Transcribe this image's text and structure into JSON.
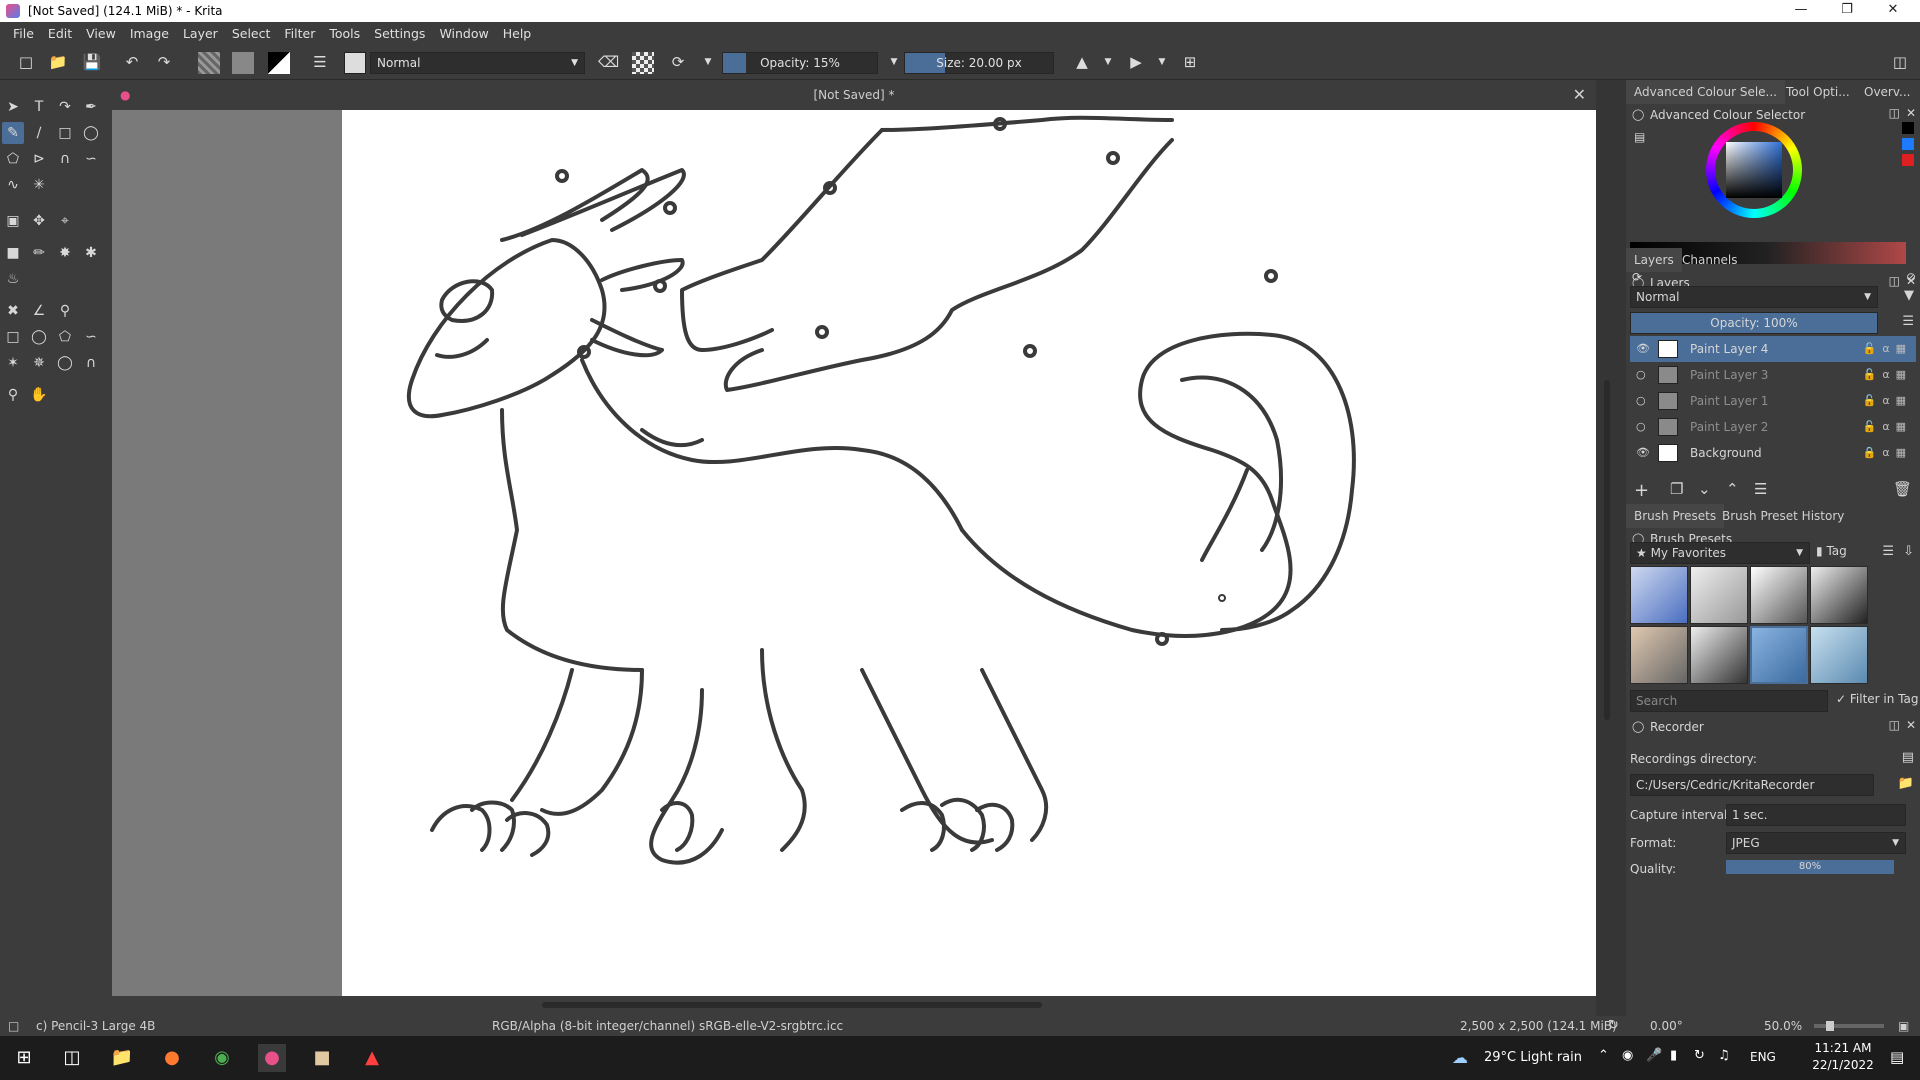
{
  "window": {
    "title": "[Not Saved]  (124.1 MiB)  * - Krita"
  },
  "menu": [
    "File",
    "Edit",
    "View",
    "Image",
    "Layer",
    "Select",
    "Filter",
    "Tools",
    "Settings",
    "Window",
    "Help"
  ],
  "toolbar": {
    "blend_mode": "Normal",
    "opacity_label": "Opacity: 15%",
    "opacity_value": 0.15,
    "size_label": "Size: 20.00 px"
  },
  "document": {
    "tab_title": "[Not Saved]  *"
  },
  "right_panel": {
    "top_tabs": [
      "Advanced Colour Sele...",
      "Tool Opti...",
      "Overv..."
    ],
    "colour_selector_title": "Advanced Colour Selector",
    "layers_tabs": [
      "Layers",
      "Channels"
    ],
    "layers_title": "Layers",
    "layers_blend": "Normal",
    "layers_opacity": "Opacity:  100%",
    "layers": [
      {
        "name": "Paint Layer 4",
        "visible": true,
        "selected": true
      },
      {
        "name": "Paint Layer 3",
        "visible": false,
        "selected": false
      },
      {
        "name": "Paint Layer 1",
        "visible": false,
        "selected": false
      },
      {
        "name": "Paint Layer 2",
        "visible": false,
        "selected": false
      },
      {
        "name": "Background",
        "visible": true,
        "selected": false
      }
    ],
    "brush_tabs": [
      "Brush Presets",
      "Brush Preset History"
    ],
    "brush_title": "Brush Presets",
    "brush_tag": "My Favorites",
    "tag_label": "Tag",
    "search_placeholder": "Search",
    "filter_in_tag": "Filter in Tag",
    "recorder_title": "Recorder",
    "recordings_directory_label": "Recordings directory:",
    "recordings_directory": "C:/Users/Cedric/KritaRecorder",
    "capture_interval_label": "Capture interval:",
    "capture_interval": "1 sec.",
    "format_label": "Format:",
    "format": "JPEG",
    "quality_label": "Quality:",
    "quality_value": "80%"
  },
  "status": {
    "brush": "c) Pencil-3 Large 4B",
    "color_info": "RGB/Alpha (8-bit integer/channel)  sRGB-elle-V2-srgbtrc.icc",
    "image_size": "2,500 x 2,500 (124.1 MiB)",
    "rotation": "0.00°",
    "zoom": "50.0%"
  },
  "taskbar": {
    "weather": "29°C  Light rain",
    "lang": "ENG",
    "time": "11:21 AM",
    "date": "22/1/2022"
  },
  "colors": {
    "accent": "#4a6e98",
    "panel": "#3c3c3c",
    "canvas_margin": "#7a7a7a"
  }
}
